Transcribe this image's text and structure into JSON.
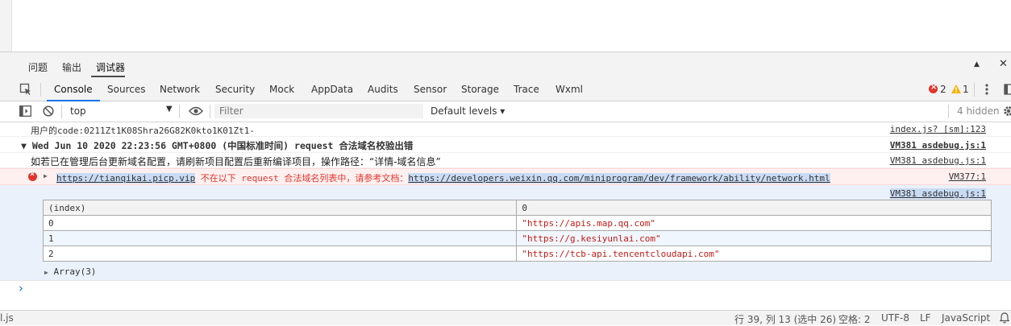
{
  "panel_tabs": [
    "问题",
    "输出",
    "调试器"
  ],
  "panel_controls": {
    "collapse": "▲",
    "close": "✕"
  },
  "devtools_tabs": [
    "Console",
    "Sources",
    "Network",
    "Security",
    "Mock",
    "AppData",
    "Audits",
    "Sensor",
    "Storage",
    "Trace",
    "Wxml"
  ],
  "badges": {
    "errors": "2",
    "warnings": "1"
  },
  "toolbar": {
    "context": "top",
    "filter_placeholder": "Filter",
    "levels": "Default levels ▾",
    "hidden": "4 hidden"
  },
  "messages": [
    {
      "text": "用户的code:0211Zt1K08Shra26G82K0kto1K01Zt1-",
      "source": "index.js? [sm]:123"
    },
    {
      "text": "▼ Wed Jun 10 2020 22:23:56 GMT+0800 (中国标准时间) request 合法域名校验出错",
      "source": "VM381 asdebug.js:1"
    },
    {
      "text": "如若已在管理后台更新域名配置，请刷新项目配置后重新编译项目，操作路径：“详情-域名信息”",
      "source": "VM381 asdebug.js:1"
    }
  ],
  "error": {
    "url": "https://tianqikai.picp.vip",
    "message": " 不在以下 request 合法域名列表中，请参考文档：",
    "doc_url": "https://developers.weixin.qq.com/miniprogram/dev/framework/ability/network.html",
    "source": "VM377:1"
  },
  "table_source": "VM381 asdebug.js:1",
  "table": {
    "headers": [
      "(index)",
      "0"
    ],
    "rows": [
      [
        "0",
        "\"https://apis.map.qq.com\""
      ],
      [
        "1",
        "\"https://g.kesiyunlai.com\""
      ],
      [
        "2",
        "\"https://tcb-api.tencentcloudapi.com\""
      ]
    ]
  },
  "array_label": "Array(3)",
  "prompt": "›",
  "statusbar": {
    "left_file": "l.js",
    "position": "行 39, 列 13 (选中 26)",
    "spaces": "空格: 2",
    "encoding": "UTF-8",
    "eol": "LF",
    "language": "JavaScript"
  }
}
